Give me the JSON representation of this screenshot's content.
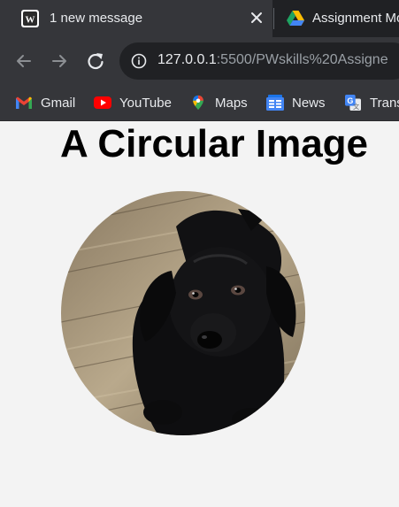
{
  "browser": {
    "tabs": [
      {
        "title": "1 new message",
        "favicon": "pw-skills-icon",
        "active": true
      },
      {
        "title": "Assignment Mo",
        "favicon": "google-drive-icon",
        "active": false
      }
    ],
    "address": {
      "host": "127.0.0.1",
      "rest": ":5500/PWskills%20Assigne"
    },
    "bookmarks": [
      {
        "label": "Gmail",
        "icon": "gmail-icon"
      },
      {
        "label": "YouTube",
        "icon": "youtube-icon"
      },
      {
        "label": "Maps",
        "icon": "maps-icon"
      },
      {
        "label": "News",
        "icon": "news-icon"
      },
      {
        "label": "Trans",
        "icon": "translate-icon"
      }
    ],
    "colors": {
      "tabstrip": "#202124",
      "toolbar": "#35363a",
      "page_bg": "#f3f3f3"
    }
  },
  "page": {
    "heading": "A Circular Image",
    "image": {
      "subject": "black puppy on wooden deck",
      "shape": "circle"
    }
  }
}
